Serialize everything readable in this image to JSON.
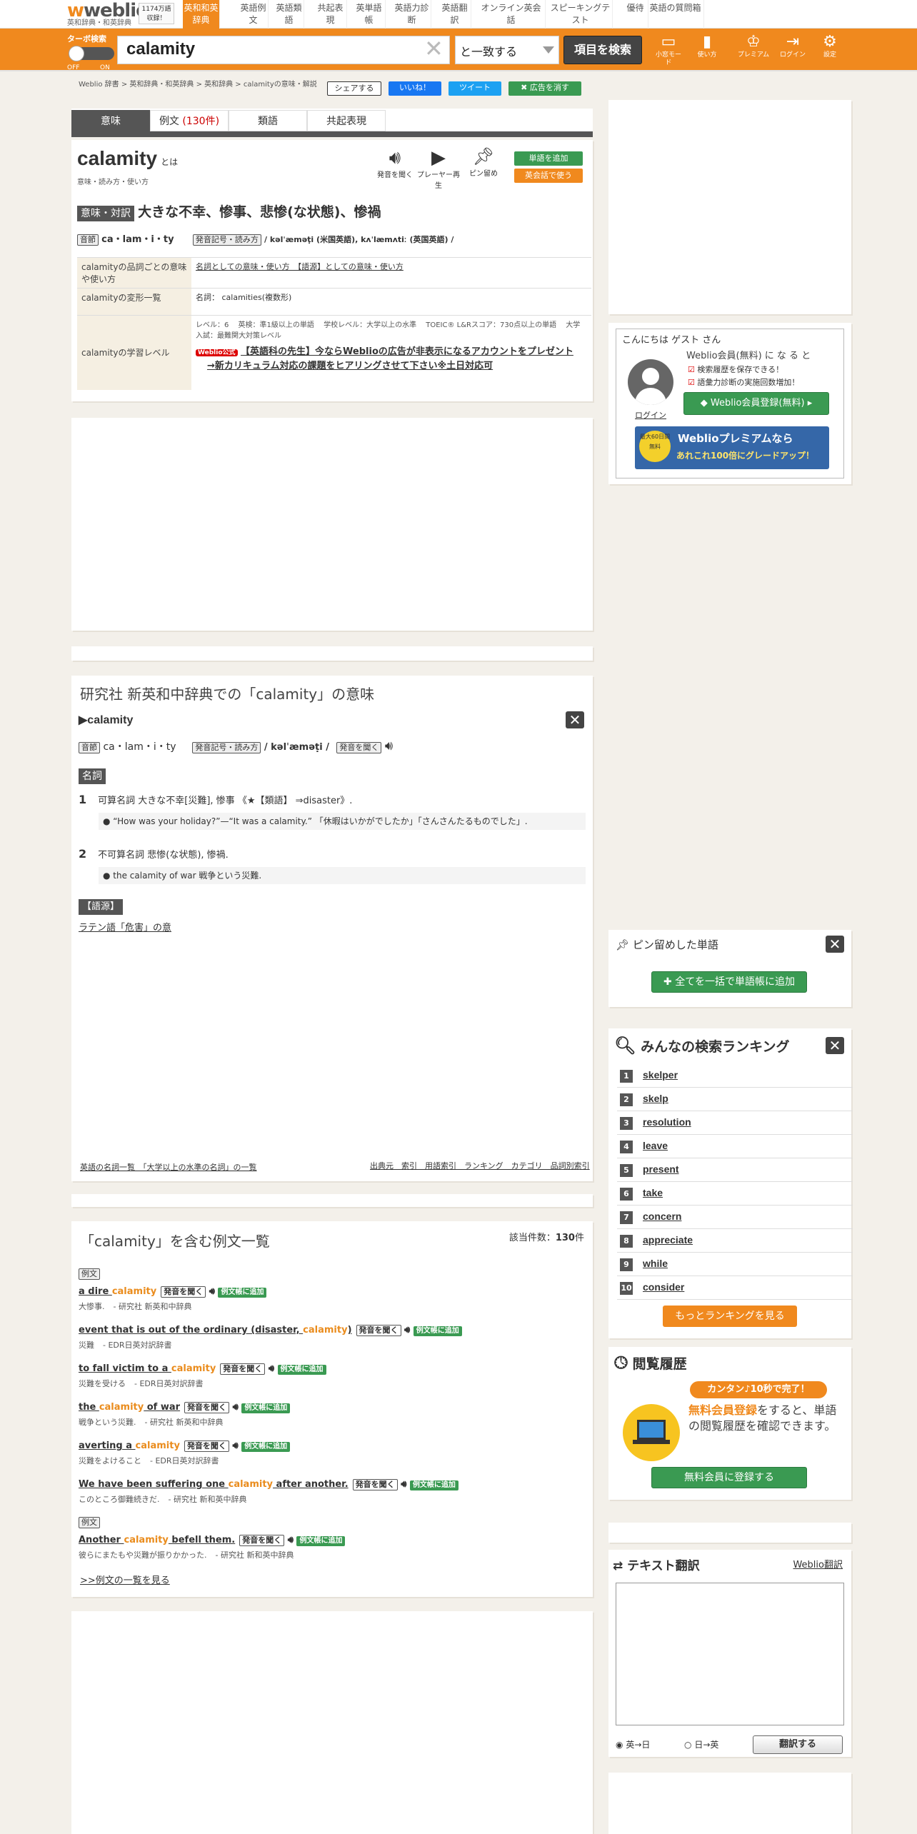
{
  "nav": {
    "logo": "weblio",
    "logo_sub": "英和辞典・和英辞典",
    "count": "1174万語収録！",
    "tabs": [
      "英和和英辞典",
      "英語例文",
      "英語類語",
      "共起表現",
      "英単語帳",
      "英語力診断",
      "英語翻訳",
      "オンライン英会話",
      "スピーキングテスト",
      "優待",
      "英語の質問箱"
    ]
  },
  "searchbar": {
    "turbo_label": "ターボ検索",
    "off": "OFF",
    "on": "ON",
    "query": "calamity",
    "match_mode": "と一致する",
    "search_button": "項目を検索",
    "icons": [
      {
        "name": "small-screen-mode-icon",
        "label": "小窓モード"
      },
      {
        "name": "howto-icon",
        "label": "使い方"
      },
      {
        "name": "premium-icon",
        "label": "プレミアム"
      },
      {
        "name": "login-icon",
        "label": "ログイン"
      },
      {
        "name": "settings-icon",
        "label": "設定"
      }
    ]
  },
  "breadcrumb": "Weblio 辞書 > 英和辞典・和英辞典 > 英和辞典 > calamityの意味・解説",
  "share": {
    "share": "シェアする",
    "like": "いいね！",
    "tweet": "ツイート",
    "hide_ads": "広告を消す"
  },
  "tabs": {
    "meaning": "意味",
    "examples": "例文",
    "examples_count": "(130件)",
    "synonyms": "類語",
    "collocations": "共起表現"
  },
  "entry": {
    "word": "calamity",
    "towa": "とは",
    "sub": "意味・読み方・使い方",
    "listen": "発音を聞く",
    "player": "プレーヤー再生",
    "pin": "ピン留め",
    "add_wordbook": "単語を追加",
    "conversation": "英会話で使う",
    "meaning_label": "意味・対訳",
    "meaning": "大きな不幸、惨事、悲惨(な状態)、惨禍",
    "syllable_label": "音節",
    "syllables": "ca・lam・i・ty",
    "pron_label": "発音記号・読み方",
    "pron": "/ kəlˈæməṭi (米国英語), kʌˈlæmʌtiː (英国英語) /",
    "table": [
      {
        "head": "calamityの品詞ごとの意味や使い方",
        "value": "名詞としての意味・使い方　【語源】としての意味・使い方"
      },
      {
        "head": "calamityの変形一覧",
        "value": "名詞： calamities(複数形)"
      },
      {
        "head": "calamityの学習レベル",
        "value": "レベル：6　 英検：準1級以上の単語　 学校レベル：大学以上の水準　 TOEIC® L&Rスコア：730点以上の単語　 大学入試：最難関大対策レベル"
      }
    ],
    "ad_badge": "Weblio公式",
    "ad_line1": "【英語科の先生】今ならWeblioの広告が非表示になるアカウントをプレゼント",
    "ad_line2": "→新カリキュラム対応の課題をヒアリングさせて下さい※土日対応可"
  },
  "kenkyusha": {
    "title": "研究社 新英和中辞典での「calamity」の意味",
    "head": "▶calamity",
    "syllable_label": "音節",
    "syllables": "ca・lam・i・ty",
    "pron_label": "発音記号・読み方",
    "pron": "/ kəlˈæməṭi /",
    "listen": "発音を聞く",
    "pos": "名詞",
    "senses": [
      {
        "num": "1",
        "text": "可算名詞 大きな不幸[災難], 惨事 《★【類語】 ⇒disaster》.",
        "ex": "“How was your holiday?”—“It was a calamity.” 「休暇はいかがでしたか」「さんさんたるものでした」."
      },
      {
        "num": "2",
        "text": "不可算名詞 悲惨(な状態), 惨禍.",
        "ex": "the calamity of war 戦争という災難."
      }
    ],
    "etym_label": "【語源】",
    "etym": "ラテン語「危害」の意",
    "footer_left": "英語の名詞一覧　「大学以上の水準の名詞」の一覧",
    "footer_right": "出典元　索引　用語索引　ランキング　カテゴリ　品詞別索引"
  },
  "examples": {
    "title": "「calamity」を含む例文一覧",
    "count_label": "該当件数：",
    "count": "130",
    "count_unit": "件",
    "label": "例文",
    "listen": "発音を聞く",
    "add": "例文帳に追加",
    "items": [
      {
        "pre": "a dire ",
        "kw": "calamity",
        "post": "",
        "ja": "大惨事.",
        "src": "- 研究社 新英和中辞典"
      },
      {
        "pre": "event that is out of the ordinary (disaster, ",
        "kw": "calamity",
        "post": ")",
        "ja": "災難",
        "src": "- EDR日英対訳辞書"
      },
      {
        "pre": "to fall victim to a ",
        "kw": "calamity",
        "post": "",
        "ja": "災難を受ける",
        "src": "- EDR日英対訳辞書"
      },
      {
        "pre": "the ",
        "kw": "calamity",
        "post": " of war",
        "ja": "戦争という災難.",
        "src": "- 研究社 新英和中辞典"
      },
      {
        "pre": "averting a ",
        "kw": "calamity",
        "post": "",
        "ja": "災難をよけること",
        "src": "- EDR日英対訳辞書"
      },
      {
        "pre": "We have been suffering one ",
        "kw": "calamity",
        "post": " after another.",
        "ja": "このところ御難続きだ.",
        "src": "- 研究社 新和英中辞典"
      },
      {
        "pre": "Another ",
        "kw": "calamity",
        "post": " befell them.",
        "ja": "彼らにまたもや災難が振りかかった.",
        "src": "- 研究社 新和英中辞典"
      }
    ],
    "more": ">>例文の一覧を見る"
  },
  "guest": {
    "hello": "こんにちは ゲスト さん",
    "login": "ログイン",
    "member": "Weblio会員(無料) に な る と",
    "benefit1": "検索履歴を保存できる！",
    "benefit2": "語彙力診断の実施回数増加！",
    "register": "Weblio会員登録(無料)",
    "premium_days": "最大60日間無料",
    "premium_title": "Weblioプレミアムなら",
    "premium_sub": "あれこれ100倍にグレードアップ！"
  },
  "pinned": {
    "title": "ピン留めした単語",
    "add_all": "全てを一括で単語帳に追加"
  },
  "ranking": {
    "title": "みんなの検索ランキング",
    "items": [
      "skelper",
      "skelp",
      "resolution",
      "leave",
      "present",
      "take",
      "concern",
      "appreciate",
      "while",
      "consider"
    ],
    "more": "もっとランキングを見る"
  },
  "history": {
    "title": "閲覧履歴",
    "badge": "カンタン♪10秒で完了！",
    "text1": "無料会員登録",
    "text2": "をすると、単語の閲覧履歴を確認できます。",
    "button": "無料会員に登録する"
  },
  "translate": {
    "title": "テキスト翻訳",
    "link": "Weblio翻訳",
    "opt1": "英→日",
    "opt2": "日→英",
    "button": "翻訳する"
  }
}
